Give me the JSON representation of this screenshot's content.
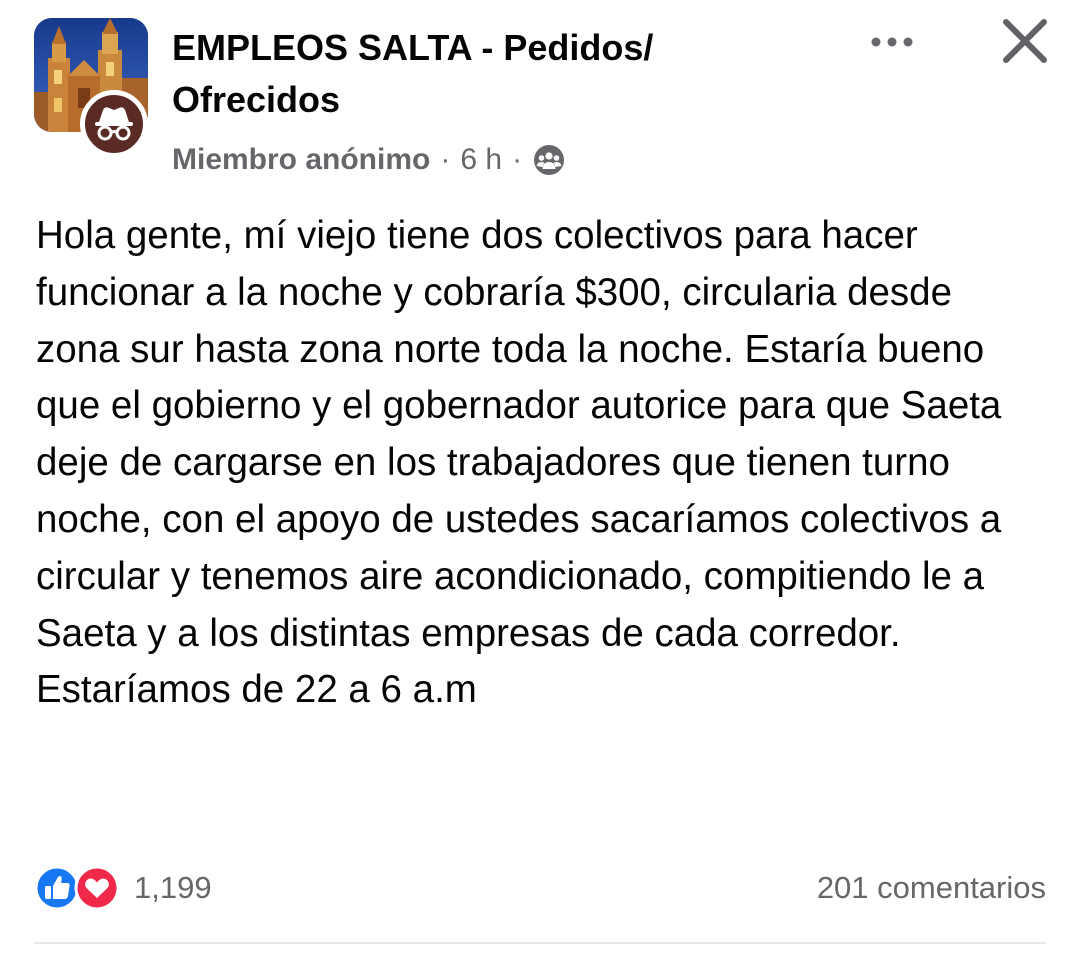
{
  "group": {
    "name": "EMPLEOS SALTA - Pedidos/ Ofrecidos"
  },
  "meta": {
    "author": "Miembro anónimo",
    "separator": "·",
    "time": "6 h",
    "privacy_icon": "group-members-icon"
  },
  "actions": {
    "more_icon": "more-options-icon",
    "close_icon": "close-icon"
  },
  "post": {
    "text": "Hola gente, mí viejo tiene dos colectivos para hacer funcionar a la noche y cobraría $300, circularia desde zona sur hasta zona norte toda la noche. Estaría bueno que el gobierno y el gobernador autorice para que Saeta deje de cargarse en los trabajadores que tienen turno noche, con el apoyo de ustedes sacaríamos colectivos a circular y tenemos aire acondicionado, compitiendo le a Saeta y a los distintas empresas de cada corredor. Estaríamos de 22 a 6 a.m"
  },
  "footer": {
    "reaction_icons": [
      "like-icon",
      "love-icon"
    ],
    "reaction_count": "1,199",
    "comments": "201 comentarios"
  },
  "colors": {
    "like": "#1877f2",
    "love": "#f0284a",
    "secondary_text": "#65676b",
    "divider": "#e4e6eb"
  }
}
